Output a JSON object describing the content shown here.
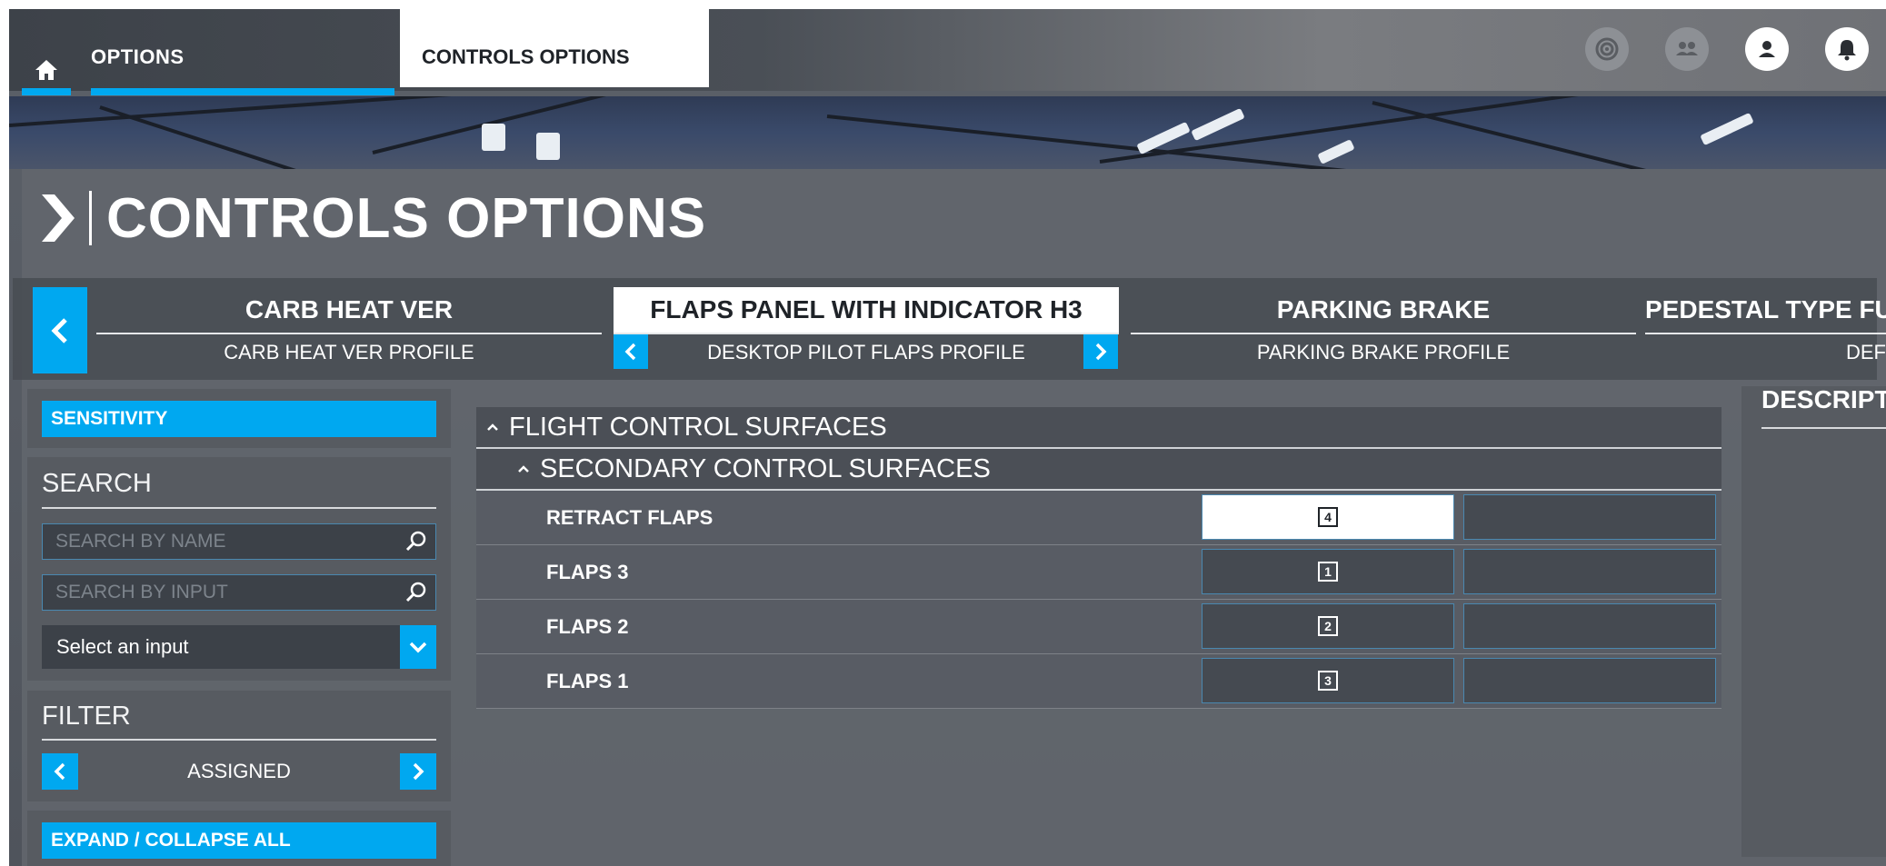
{
  "header": {
    "options_tab": "OPTIONS",
    "controls_tab": "CONTROLS OPTIONS",
    "icons": [
      "home-icon",
      "achievements-icon",
      "friends-icon",
      "profile-icon",
      "notifications-icon"
    ]
  },
  "page": {
    "title": "CONTROLS OPTIONS"
  },
  "devices": [
    {
      "name": "CARB HEAT VER",
      "profile": "CARB HEAT VER PROFILE"
    },
    {
      "name": "FLAPS PANEL WITH INDICATOR H3",
      "profile": "DESKTOP PILOT FLAPS PROFILE"
    },
    {
      "name": "PARKING BRAKE",
      "profile": "PARKING BRAKE PROFILE"
    },
    {
      "name": "PEDESTAL TYPE FU",
      "profile": "DEF"
    }
  ],
  "sidebar": {
    "sensitivity": "SENSITIVITY",
    "search_label": "SEARCH",
    "search_by_name": "SEARCH BY NAME",
    "search_by_input": "SEARCH BY INPUT",
    "select_input": "Select an input",
    "filter_label": "FILTER",
    "filter_value": "ASSIGNED",
    "expand_collapse": "EXPAND / COLLAPSE ALL"
  },
  "list": {
    "category": "FLIGHT CONTROL SURFACES",
    "subcategory": "SECONDARY CONTROL SURFACES",
    "rows": [
      {
        "label": "RETRACT FLAPS",
        "key": "4"
      },
      {
        "label": "FLAPS 3",
        "key": "1"
      },
      {
        "label": "FLAPS 2",
        "key": "2"
      },
      {
        "label": "FLAPS 1",
        "key": "3"
      }
    ]
  },
  "description": {
    "title": "DESCRIPT"
  },
  "colors": {
    "accent": "#00a8f0",
    "panel": "#5b6068",
    "selected_slot": "#ffffff"
  }
}
